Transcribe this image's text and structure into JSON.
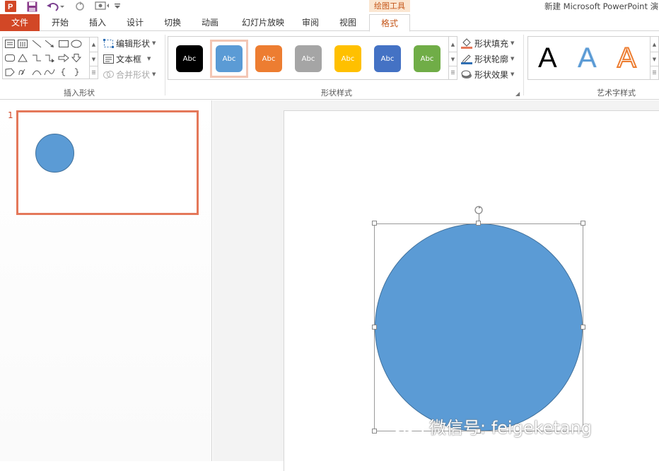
{
  "window_title": "新建 Microsoft PowerPoint 演",
  "context_tools_label": "绘图工具",
  "tabs": [
    "文件",
    "开始",
    "插入",
    "设计",
    "切换",
    "动画",
    "幻灯片放映",
    "审阅",
    "视图",
    "格式"
  ],
  "active_tab": "格式",
  "ribbon": {
    "insert_shapes": {
      "label": "插入形状",
      "edit_shape": "编辑形状",
      "text_box": "文本框",
      "merge_shapes": "合并形状"
    },
    "shape_styles": {
      "label": "形状样式",
      "swatch_text": "Abc",
      "swatches": [
        "#000000",
        "#5b9bd5",
        "#ed7d31",
        "#a5a5a5",
        "#ffc000",
        "#4472c4",
        "#70ad47"
      ],
      "selected_index": 1,
      "shape_fill": "形状填充",
      "shape_outline": "形状轮廓",
      "shape_effects": "形状效果"
    },
    "wordart_styles": {
      "label": "艺术字样式",
      "glyph": "A"
    }
  },
  "thumbnail": {
    "slide_number": "1"
  },
  "slide": {
    "shape": "circle",
    "fill": "#5b9bd5",
    "outline": "#41719c",
    "selected": true
  },
  "watermark": "微信号: feigeketang",
  "colors": {
    "accent": "#d24726",
    "format_tab": "#c5571a",
    "context_bg": "#fbe6d1"
  }
}
